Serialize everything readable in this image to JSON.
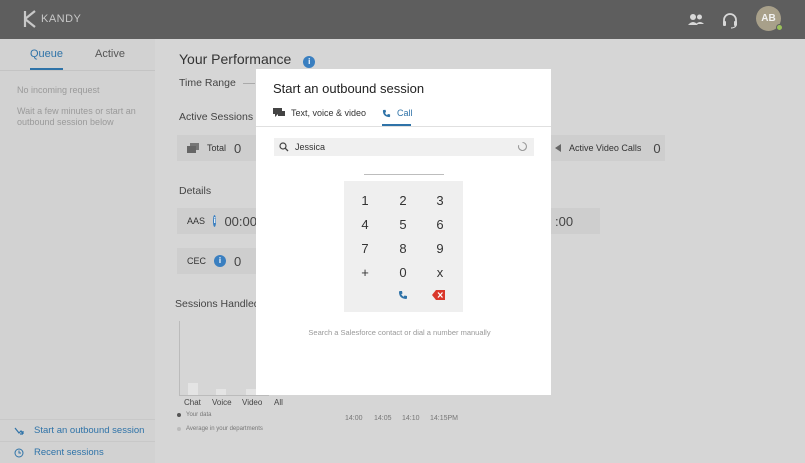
{
  "header": {
    "logo_text": "KANDY",
    "avatar_initials": "AB"
  },
  "sidebar": {
    "tabs": [
      "Queue",
      "Active"
    ],
    "no_request_text": "No incoming request",
    "wait_text": "Wait a few minutes or start an outbound session below",
    "links": [
      "Start an outbound session",
      "Recent sessions"
    ]
  },
  "main": {
    "title": "Your Performance",
    "time_range_label": "Time Range",
    "active_sessions_label": "Active Sessions",
    "total_label": "Total",
    "total_value": "0",
    "active_video_label": "Active Video Calls",
    "active_video_value": "0",
    "details_label": "Details",
    "aas_label": "AAS",
    "aas_value": "00:00",
    "aas_right_value": ":00",
    "cec_label": "CEC",
    "cec_value": "0",
    "sessions_handled_label": "Sessions Handled",
    "bar_categories": [
      "Chat",
      "Voice",
      "Video",
      "All"
    ],
    "time_ticks": [
      "14:00",
      "14:05",
      "14:10",
      "14:15PM"
    ],
    "legend": [
      "Your data",
      "Average in your departments"
    ]
  },
  "modal": {
    "title": "Start an outbound session",
    "tabs": [
      "Text, voice & video",
      "Call"
    ],
    "search_value": "Jessica",
    "keys": [
      "1",
      "2",
      "3",
      "4",
      "5",
      "6",
      "7",
      "8",
      "9",
      "+",
      "0",
      "x"
    ],
    "hint": "Search a Salesforce contact or dial a number manually"
  },
  "colors": {
    "accent": "#2f73a8",
    "topbar": "#5e5e5e",
    "delete": "#d9372b",
    "status_online": "#9bc25a"
  }
}
